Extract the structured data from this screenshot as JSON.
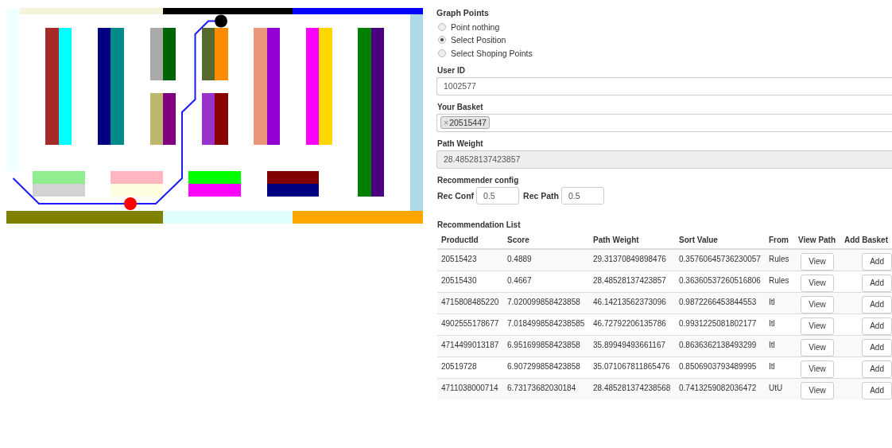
{
  "graph_points": {
    "title": "Graph Points",
    "options": [
      {
        "label": "Point nothing",
        "selected": false
      },
      {
        "label": "Select Position",
        "selected": true
      },
      {
        "label": "Select Shoping Points",
        "selected": false
      }
    ]
  },
  "user_id": {
    "label": "User ID",
    "value": "1002577"
  },
  "basket": {
    "label": "Your Basket",
    "tags": [
      {
        "remove": "×",
        "text": "20515447"
      }
    ]
  },
  "path_weight": {
    "label": "Path Weight",
    "value": "28.48528137423857",
    "disabled": true
  },
  "recommender_config": {
    "title": "Recommender config",
    "fields": [
      {
        "label": "Rec Conf",
        "value": "0.5"
      },
      {
        "label": "Rec Path",
        "value": "0.5"
      }
    ]
  },
  "recommendation_list": {
    "title": "Recommendation List",
    "columns": [
      "ProductId",
      "Score",
      "Path Weight",
      "Sort Value",
      "From",
      "View Path",
      "Add Basket"
    ],
    "rows": [
      {
        "cells": [
          "20515423",
          "0.4889",
          "29.31370849898476",
          "0.35760645736230057",
          "Rules"
        ],
        "view": "View",
        "add": "Add"
      },
      {
        "cells": [
          "20515430",
          "0.4667",
          "28.48528137423857",
          "0.36360537260516806",
          "Rules"
        ],
        "view": "View",
        "add": "Add"
      },
      {
        "cells": [
          "4715808485220",
          "7.020099858423858",
          "46.14213562373096",
          "0.9872266453844553",
          "Itl"
        ],
        "view": "View",
        "add": "Add"
      },
      {
        "cells": [
          "4902555178677",
          "7.0184998584238585",
          "46.72792206135786",
          "0.9931225081802177",
          "Itl"
        ],
        "view": "View",
        "add": "Add"
      },
      {
        "cells": [
          "4714499013187",
          "6.951699858423858",
          "35.89949493661167",
          "0.8636362138493299",
          "Itl"
        ],
        "view": "View",
        "add": "Add"
      },
      {
        "cells": [
          "20519728",
          "6.907299858423858",
          "35.071067811865476",
          "0.8506903793489995",
          "Itl"
        ],
        "view": "View",
        "add": "Add"
      },
      {
        "cells": [
          "4711038000714",
          "6.73173682030184",
          "28.485281374238568",
          "0.7413259082036472",
          "UtU"
        ],
        "view": "View",
        "add": "Add"
      }
    ]
  }
}
